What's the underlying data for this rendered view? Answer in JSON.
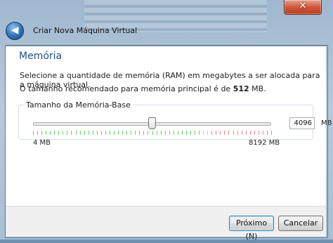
{
  "window": {
    "close_glyph": "✕",
    "back_glyph": "◀",
    "wizard_title": "Criar Nova Máquina Virtual"
  },
  "page": {
    "heading": "Memória",
    "description": "Selecione a quantidade de memória (RAM) em megabytes a ser alocada para a máquina virtual.",
    "recommend_prefix": "O tamanho recomendado para memória principal é de ",
    "recommend_value": "512",
    "recommend_suffix": " MB."
  },
  "memory": {
    "group_label": "Tamanho da Memória-Base",
    "value": "4096",
    "unit": "MB",
    "min_label": "4 MB",
    "max_label": "8192 MB",
    "min": 4,
    "max": 8192,
    "current": 4096,
    "zones": {
      "green_until": 5734,
      "red_from": 6144
    },
    "colors": {
      "green": "#6fd06f",
      "red": "#ee8a8a",
      "neutral": "#c8c8c8"
    }
  },
  "buttons": {
    "next": "Próximo (N)",
    "cancel": "Cancelar"
  }
}
